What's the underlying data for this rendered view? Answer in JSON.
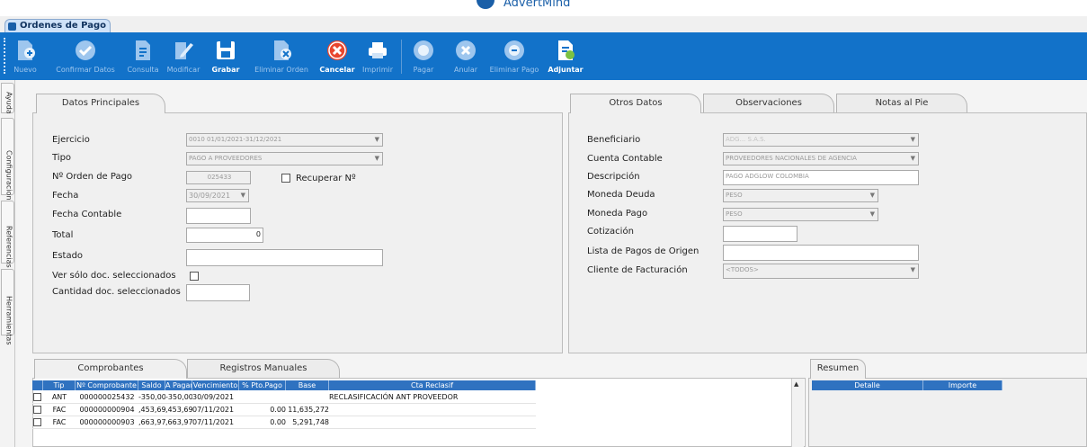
{
  "brand": {
    "name": "AdvertMind"
  },
  "window_tab": {
    "title": "Ordenes de Pago"
  },
  "toolbar": {
    "nuevo": "Nuevo",
    "confirmar": "Confirmar Datos",
    "consulta": "Consulta",
    "modificar": "Modificar",
    "grabar": "Grabar",
    "eliminar_orden": "Eliminar Orden",
    "cancelar": "Cancelar",
    "imprimir": "Imprimir",
    "pagar": "Pagar",
    "anular": "Anular",
    "eliminar_pago": "Eliminar Pago",
    "adjuntar": "Adjuntar"
  },
  "side_tabs": {
    "ayuda": "Ayuda",
    "configuraciones": "Configuraciones",
    "referencias": "Referencias",
    "herramientas": "Herramientas"
  },
  "left_tabs": {
    "datos_principales": "Datos Principales"
  },
  "datos": {
    "ejercicio_label": "Ejercicio",
    "ejercicio_value": "0010 01/01/2021-31/12/2021",
    "tipo_label": "Tipo",
    "tipo_value": "PAGO A PROVEEDORES",
    "orden_label": "Nº Orden de Pago",
    "orden_value": "025433",
    "recuperar_label": "Recuperar Nº",
    "fecha_label": "Fecha",
    "fecha_value": "30/09/2021",
    "fecha_contable_label": "Fecha Contable",
    "total_label": "Total",
    "total_value": "0",
    "estado_label": "Estado",
    "ver_solo_label": "Ver sólo doc. seleccionados",
    "cantidad_label": "Cantidad doc. seleccionados"
  },
  "right_tabs": {
    "otros": "Otros Datos",
    "observaciones": "Observaciones",
    "notas": "Notas al Pie"
  },
  "otros": {
    "beneficiario_label": "Beneficiario",
    "beneficiario_value": "ADG... S.A.S.",
    "cuenta_label": "Cuenta Contable",
    "cuenta_value": "PROVEEDORES NACIONALES DE AGENCIA",
    "descripcion_label": "Descripción",
    "descripcion_value": "PAGO ADGLOW COLOMBIA",
    "moneda_deuda_label": "Moneda Deuda",
    "moneda_deuda_value": "PESO",
    "moneda_pago_label": "Moneda Pago",
    "moneda_pago_value": "PESO",
    "cotizacion_label": "Cotización",
    "lista_label": "Lista de Pagos de Origen",
    "cliente_label": "Cliente de Facturación",
    "cliente_value": "<TODOS>"
  },
  "bottom_tabs": {
    "comprobantes": "Comprobantes",
    "registros": "Registros Manuales",
    "resumen": "Resumen"
  },
  "grid": {
    "headers": [
      "Tip",
      "Nº Comprobante",
      "Saldo",
      "A Pagar",
      "Vencimiento",
      "% Pto.Pago",
      "Base",
      "Cta Reclasif"
    ],
    "rows": [
      [
        "ANT",
        "000000025432",
        "-350,000",
        "-350,000",
        "30/09/2021",
        "",
        "",
        "RECLASIFICACIÓN ANT PROVEEDOR"
      ],
      [
        "FAC",
        "000000000904",
        ",453,697",
        ",453,697",
        "07/11/2021",
        "0.00",
        "11,635,272",
        ""
      ],
      [
        "FAC",
        "000000000903",
        ",663,970",
        ",663,970",
        "07/11/2021",
        "0.00",
        "5,291,748",
        ""
      ]
    ]
  },
  "resumen_grid": {
    "headers": [
      "Detalle",
      "Importe"
    ]
  },
  "colors": {
    "toolbar": "#1272c9",
    "grid_header": "#2f72c0"
  }
}
